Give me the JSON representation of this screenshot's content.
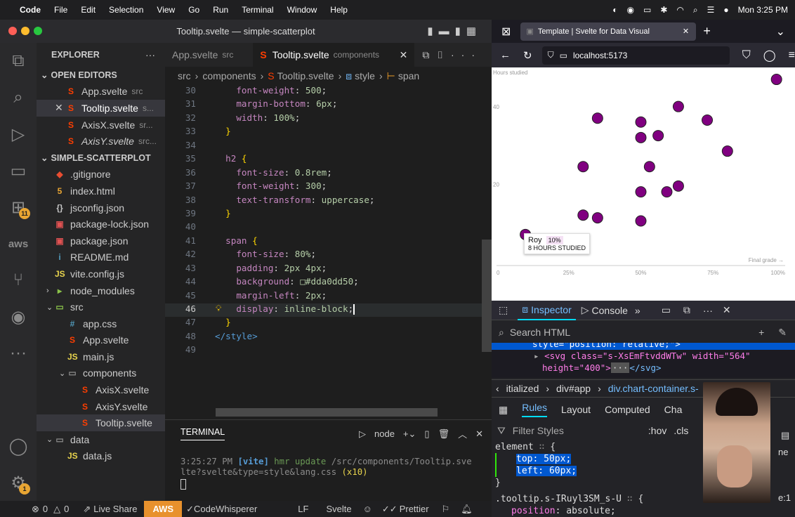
{
  "menubar": {
    "app": "Code",
    "items": [
      "File",
      "Edit",
      "Selection",
      "View",
      "Go",
      "Run",
      "Terminal",
      "Window",
      "Help"
    ],
    "clock": "Mon 3:25 PM"
  },
  "vscode": {
    "title": "Tooltip.svelte — simple-scatterplot",
    "explorer": "EXPLORER",
    "open_editors": "OPEN EDITORS",
    "open_files": [
      {
        "name": "App.svelte",
        "dir": "src",
        "icon": "S",
        "color": "#ff3e00"
      },
      {
        "name": "Tooltip.svelte",
        "dir": "s...",
        "icon": "S",
        "color": "#ff3e00"
      },
      {
        "name": "AxisX.svelte",
        "dir": "sr...",
        "icon": "S",
        "color": "#ff3e00"
      },
      {
        "name": "AxisY.svelte",
        "dir": "src...",
        "icon": "S",
        "color": "#ff3e00"
      }
    ],
    "project": "SIMPLE-SCATTERPLOT",
    "tree": [
      {
        "name": ".gitignore",
        "icon": "◆",
        "color": "#e84d31",
        "indent": 0
      },
      {
        "name": "index.html",
        "icon": "5",
        "color": "#e8a533",
        "indent": 0
      },
      {
        "name": "jsconfig.json",
        "icon": "{}",
        "color": "#c5c5c5",
        "indent": 0
      },
      {
        "name": "package-lock.json",
        "icon": "▣",
        "color": "#e05252",
        "indent": 0
      },
      {
        "name": "package.json",
        "icon": "▣",
        "color": "#e05252",
        "indent": 0
      },
      {
        "name": "README.md",
        "icon": "i",
        "color": "#519aba",
        "indent": 0
      },
      {
        "name": "vite.config.js",
        "icon": "JS",
        "color": "#e8d44d",
        "indent": 0
      },
      {
        "name": "node_modules",
        "icon": "▸",
        "color": "#8bc34a",
        "indent": 0
      },
      {
        "name": "src",
        "icon": "▭",
        "color": "#8bc34a",
        "indent": 0
      },
      {
        "name": "app.css",
        "icon": "#",
        "color": "#519aba",
        "indent": 1
      },
      {
        "name": "App.svelte",
        "icon": "S",
        "color": "#ff3e00",
        "indent": 1
      },
      {
        "name": "main.js",
        "icon": "JS",
        "color": "#e8d44d",
        "indent": 1
      },
      {
        "name": "components",
        "icon": "▭",
        "color": "#8b8b8b",
        "indent": 1
      },
      {
        "name": "AxisX.svelte",
        "icon": "S",
        "color": "#ff3e00",
        "indent": 2
      },
      {
        "name": "AxisY.svelte",
        "icon": "S",
        "color": "#ff3e00",
        "indent": 2
      },
      {
        "name": "Tooltip.svelte",
        "icon": "S",
        "color": "#ff3e00",
        "indent": 2
      },
      {
        "name": "data",
        "icon": "▭",
        "color": "#8b8b8b",
        "indent": 0
      },
      {
        "name": "data.js",
        "icon": "JS",
        "color": "#e8d44d",
        "indent": 1
      }
    ],
    "tabs": [
      {
        "name": "App.svelte",
        "dir": "src"
      },
      {
        "name": "Tooltip.svelte",
        "dir": "components"
      }
    ],
    "breadcrumb": [
      "src",
      "components",
      "Tooltip.svelte",
      "style",
      "span"
    ],
    "code": [
      {
        "n": "30",
        "parts": [
          [
            "p",
            "    font-weight"
          ],
          [
            "w",
            ": "
          ],
          [
            "v",
            "500"
          ],
          [
            "w",
            ";"
          ]
        ]
      },
      {
        "n": "31",
        "parts": [
          [
            "p",
            "    margin-bottom"
          ],
          [
            "w",
            ": "
          ],
          [
            "v",
            "6px"
          ],
          [
            "w",
            ";"
          ]
        ]
      },
      {
        "n": "32",
        "parts": [
          [
            "p",
            "    width"
          ],
          [
            "w",
            ": "
          ],
          [
            "v",
            "100%"
          ],
          [
            "w",
            ";"
          ]
        ]
      },
      {
        "n": "33",
        "parts": [
          [
            "y",
            "  }"
          ]
        ]
      },
      {
        "n": "34",
        "parts": []
      },
      {
        "n": "35",
        "parts": [
          [
            "p",
            "  h2 "
          ],
          [
            "y",
            "{"
          ]
        ]
      },
      {
        "n": "36",
        "parts": [
          [
            "p",
            "    font-size"
          ],
          [
            "w",
            ": "
          ],
          [
            "v",
            "0.8rem"
          ],
          [
            "w",
            ";"
          ]
        ]
      },
      {
        "n": "37",
        "parts": [
          [
            "p",
            "    font-weight"
          ],
          [
            "w",
            ": "
          ],
          [
            "v",
            "300"
          ],
          [
            "w",
            ";"
          ]
        ]
      },
      {
        "n": "38",
        "parts": [
          [
            "p",
            "    text-transform"
          ],
          [
            "w",
            ": "
          ],
          [
            "v",
            "uppercase"
          ],
          [
            "w",
            ";"
          ]
        ]
      },
      {
        "n": "39",
        "parts": [
          [
            "y",
            "  }"
          ]
        ]
      },
      {
        "n": "40",
        "parts": []
      },
      {
        "n": "41",
        "parts": [
          [
            "p",
            "  span "
          ],
          [
            "y",
            "{"
          ]
        ]
      },
      {
        "n": "42",
        "parts": [
          [
            "p",
            "    font-size"
          ],
          [
            "w",
            ": "
          ],
          [
            "v",
            "80%"
          ],
          [
            "w",
            ";"
          ]
        ]
      },
      {
        "n": "43",
        "parts": [
          [
            "p",
            "    padding"
          ],
          [
            "w",
            ": "
          ],
          [
            "v",
            "2px 4px"
          ],
          [
            "w",
            ";"
          ]
        ]
      },
      {
        "n": "44",
        "parts": [
          [
            "p",
            "    background"
          ],
          [
            "w",
            ": "
          ],
          [
            "v",
            "□#dda0dd50"
          ],
          [
            "w",
            ";"
          ]
        ]
      },
      {
        "n": "45",
        "parts": [
          [
            "p",
            "    margin-left"
          ],
          [
            "w",
            ": "
          ],
          [
            "v",
            "2px"
          ],
          [
            "w",
            ";"
          ]
        ]
      },
      {
        "n": "46",
        "parts": [
          [
            "p",
            "    display"
          ],
          [
            "w",
            ": "
          ],
          [
            "v",
            "inline-block"
          ],
          [
            "w",
            ";"
          ]
        ]
      },
      {
        "n": "47",
        "parts": [
          [
            "y",
            "  }"
          ]
        ]
      },
      {
        "n": "48",
        "parts": [
          [
            "t",
            "</style"
          ],
          [
            "t",
            ">"
          ]
        ]
      },
      {
        "n": "49",
        "parts": []
      }
    ],
    "terminal": {
      "tab": "TERMINAL",
      "shell": "node",
      "line1a": "3:25:27 PM ",
      "line1b": "[vite]",
      "line1c": " hmr update ",
      "line1d": "/src/components/Tooltip.sve",
      "line2a": "lte?svelte&type=style&lang.css ",
      "line2b": "(x10)"
    },
    "status": {
      "errors": "0",
      "warnings": "0",
      "live": "Live Share",
      "aws": "AWS",
      "cw": "CodeWhisperer",
      "eol": "LF",
      "lang": "Svelte",
      "prettier": "Prettier"
    }
  },
  "browser": {
    "tab": "Template | Svelte for Data Visual",
    "url": "localhost:5173",
    "tooltip": {
      "name": "Roy",
      "pct": "10%",
      "sub": "8 HOURS STUDIED"
    },
    "devtools": {
      "tabs": [
        "Inspector",
        "Console"
      ],
      "search": "Search HTML",
      "html1": "style=\"position: relative;\">",
      "html2a": "<svg class=\"s-XsEmFtvddWTw\" width=\"564\"",
      "html2b": "height=\"400\">",
      "html2c": "</svg>",
      "crumbs": [
        "itialized",
        "div#app",
        "div.chart-container.s-"
      ],
      "rules_tabs": [
        "Rules",
        "Layout",
        "Computed",
        "Cha"
      ],
      "filter": "Filter Styles",
      "hov": ":hov",
      "cls": ".cls",
      "element": "element",
      "top": "top: 50px;",
      "left": "left: 60px;",
      "rule2": ".tooltip.s-IRuyl3SM_s-U",
      "rule2prop": "position",
      "rule2val": "absolute;",
      "side1": "ne",
      "side2": "e:1"
    }
  },
  "chart_data": {
    "type": "scatter",
    "xlabel": "Final grade →",
    "ylabel": "Hours studied",
    "xticks": [
      "0",
      "25%",
      "50%",
      "75%",
      "100%"
    ],
    "yticks": [
      "20",
      "40"
    ],
    "xlim": [
      0,
      100
    ],
    "ylim": [
      0,
      50
    ],
    "points": [
      {
        "x": 97,
        "y": 48
      },
      {
        "x": 63,
        "y": 41
      },
      {
        "x": 35,
        "y": 38
      },
      {
        "x": 50,
        "y": 37
      },
      {
        "x": 73,
        "y": 37.5
      },
      {
        "x": 50,
        "y": 33
      },
      {
        "x": 56,
        "y": 33.5
      },
      {
        "x": 80,
        "y": 29.5
      },
      {
        "x": 30,
        "y": 25.5
      },
      {
        "x": 53,
        "y": 25.5
      },
      {
        "x": 63,
        "y": 20.5
      },
      {
        "x": 50,
        "y": 19
      },
      {
        "x": 59,
        "y": 19
      },
      {
        "x": 30,
        "y": 13
      },
      {
        "x": 35,
        "y": 12.3
      },
      {
        "x": 50,
        "y": 11.5
      },
      {
        "x": 10,
        "y": 8
      }
    ],
    "marker_color": "#800080"
  }
}
